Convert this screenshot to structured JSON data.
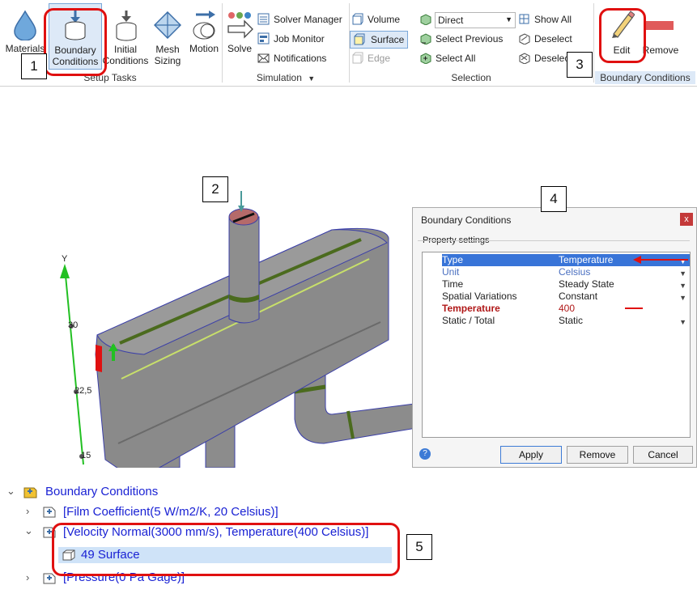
{
  "ribbon": {
    "setup": {
      "items": [
        {
          "label": "Materials"
        },
        {
          "label": "Boundary\nConditions"
        },
        {
          "label": "Initial\nConditions"
        },
        {
          "label": "Mesh\nSizing"
        },
        {
          "label": "Motion"
        }
      ],
      "group_label": "Setup Tasks"
    },
    "simulation": {
      "solve_label": "Solve",
      "solver_manager": "Solver Manager",
      "job_monitor": "Job Monitor",
      "notifications": "Notifications",
      "group_label": "Simulation"
    },
    "selection": {
      "volume": "Volume",
      "surface": "Surface",
      "edge": "Edge",
      "direct": "Direct",
      "select_previous": "Select Previous",
      "select_all": "Select All",
      "show_all": "Show All",
      "deselect": "Deselect",
      "deselect2": "Deselec",
      "group_label": "Selection"
    },
    "bc": {
      "edit": "Edit",
      "remove": "Remove",
      "group_label": "Boundary Conditions"
    }
  },
  "callouts": [
    "1",
    "2",
    "3",
    "4",
    "5"
  ],
  "axis": {
    "label": "Y",
    "ticks": [
      "30",
      "22,5",
      "15"
    ]
  },
  "dialog": {
    "title": "Boundary Conditions",
    "close": "x",
    "group_label": "Property settings",
    "rows": [
      {
        "name": "Type",
        "value": "Temperature"
      },
      {
        "name": "Unit",
        "value": "Celsius"
      },
      {
        "name": "Time",
        "value": "Steady State"
      },
      {
        "name": "Spatial Variations",
        "value": "Constant"
      },
      {
        "name": "Temperature",
        "value": "400"
      },
      {
        "name": "Static / Total",
        "value": "Static"
      }
    ],
    "buttons": {
      "apply": "Apply",
      "remove": "Remove",
      "cancel": "Cancel"
    },
    "help": "?"
  },
  "tree": {
    "root": "Boundary Conditions",
    "items": [
      {
        "label": "[Film Coefficient(5 W/m2/K, 20 Celsius)]"
      },
      {
        "label": "[Velocity Normal(3000 mm/s), Temperature(400 Celsius)]"
      },
      {
        "label": "49 Surface"
      },
      {
        "label": "[Pressure(0 Pa Gage)]"
      }
    ]
  },
  "colors": {
    "accent_red": "#e01010",
    "tree_text": "#1a22d4",
    "selected_row": "#3874d8",
    "geometry": "#8c8c8c",
    "axis_green": "#22c022"
  }
}
